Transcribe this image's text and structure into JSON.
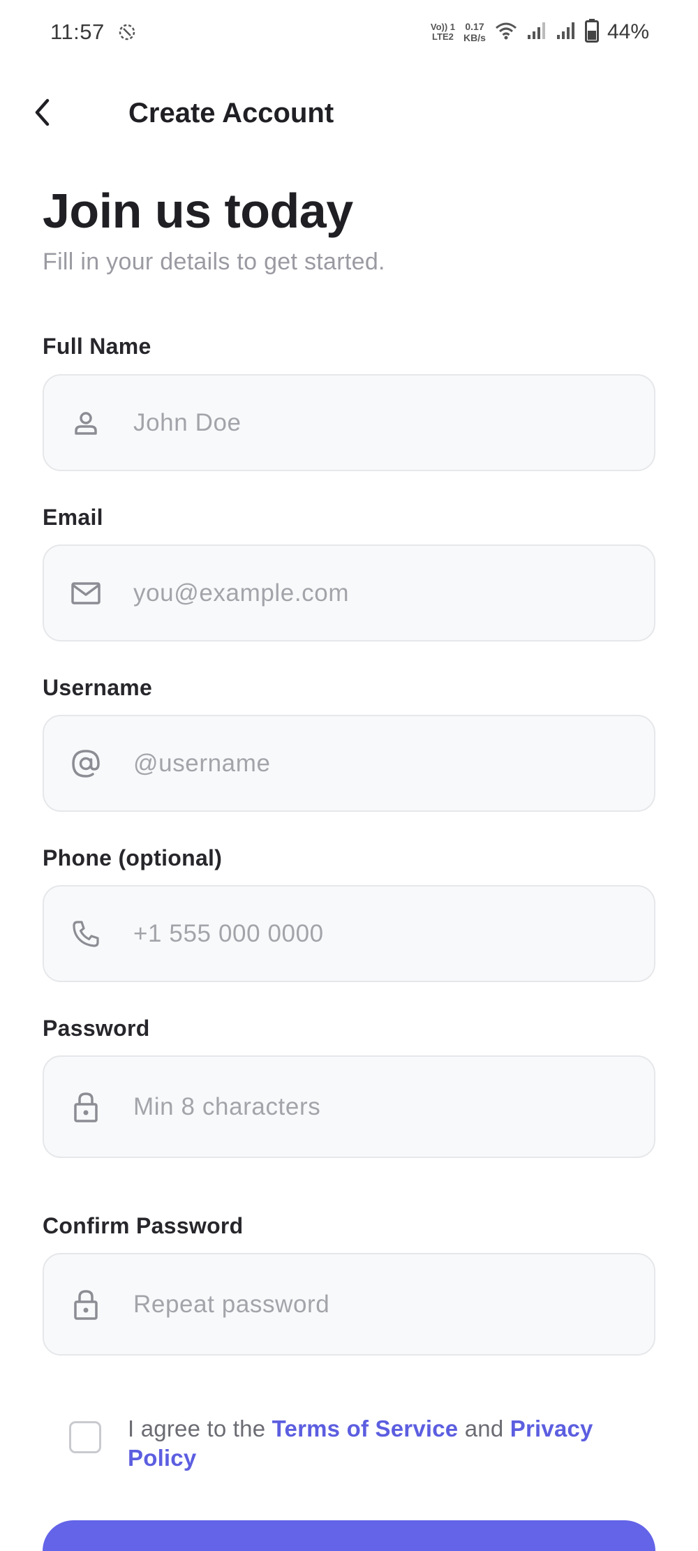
{
  "status_bar": {
    "time": "11:57",
    "volte_top": "Vo)) 1",
    "volte_bottom": "LTE2",
    "net_speed_value": "0.17",
    "net_speed_unit": "KB/s",
    "battery_percent": "44%"
  },
  "app_bar": {
    "title": "Create Account"
  },
  "header": {
    "headline": "Join us today",
    "subheadline": "Fill in your details to get started."
  },
  "form": {
    "full_name": {
      "label": "Full Name",
      "placeholder": "John Doe",
      "value": ""
    },
    "email": {
      "label": "Email",
      "placeholder": "you@example.com",
      "value": ""
    },
    "username": {
      "label": "Username",
      "placeholder": "@username",
      "value": ""
    },
    "phone": {
      "label": "Phone (optional)",
      "placeholder": "+1 555 000 0000",
      "value": ""
    },
    "password": {
      "label": "Password",
      "placeholder": "Min 8 characters",
      "value": ""
    },
    "confirm_password": {
      "label": "Confirm Password",
      "placeholder": "Repeat password",
      "value": ""
    }
  },
  "agreement": {
    "checked": false,
    "prefix": "I agree to the ",
    "terms_link": "Terms of Service",
    "middle": " and ",
    "privacy_link": "Privacy Policy"
  },
  "icons": {
    "back": "chevron-left-icon",
    "full_name": "person-icon",
    "email": "mail-icon",
    "username": "at-sign-icon",
    "phone": "phone-icon",
    "password": "lock-icon",
    "confirm_password": "lock-icon"
  },
  "colors": {
    "accent": "#6364e8",
    "link": "#5c5ee0",
    "field_background": "#f8f9fa",
    "field_border": "#e6e7ea",
    "placeholder": "#a3a4aa",
    "subtitle": "#9a9aa2"
  }
}
